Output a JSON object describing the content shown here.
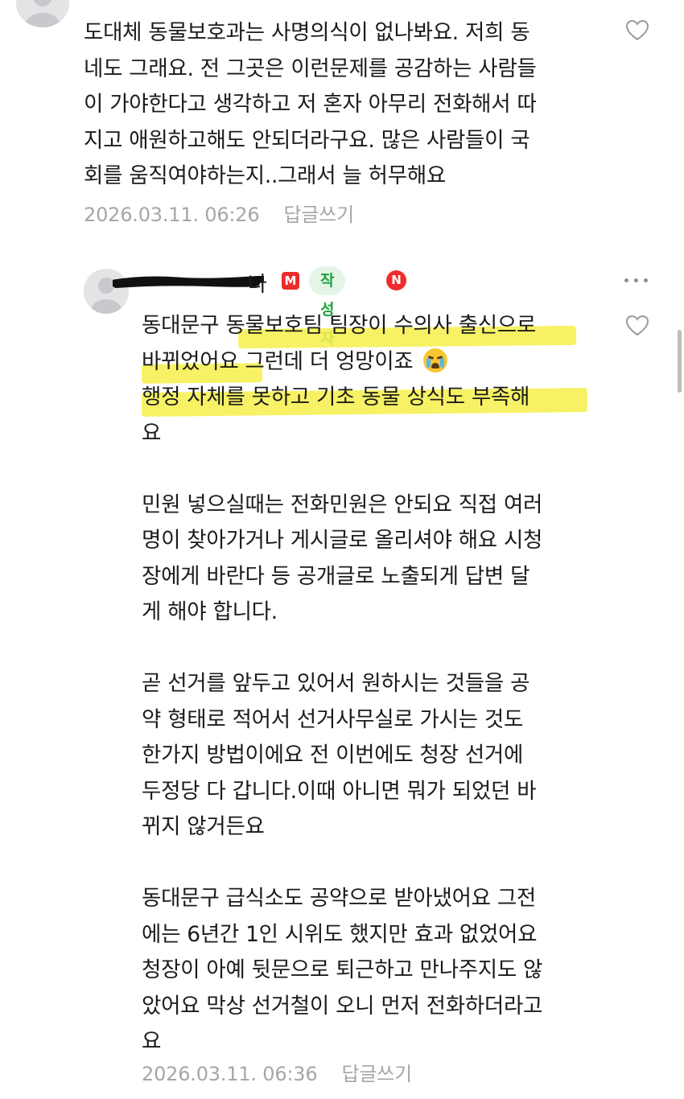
{
  "comment1": {
    "lines": [
      "도대체 동물보호과는 사명의식이 없나봐요. 저희 동",
      "네도 그래요. 전 그곳은 이런문제를 공감하는 사람들",
      "이 가야한다고 생각하고 저 혼자 아무리 전화해서 따",
      "지고 애원하고해도 안되더라구요. 많은 사람들이 국",
      "회를 움직여야하는지..그래서 늘 허무해요"
    ],
    "timestamp": "2026.03.11. 06:26",
    "reply_label": "답글쓰기"
  },
  "comment2": {
    "nickname_visible": "나",
    "badge_m": "M",
    "writer_badge": "작성자",
    "badge_n": "N",
    "lines": [
      "동대문구 동물보호팀 팀장이 수의사 출신으로",
      "바뀌었어요 그런데 더 엉망이죠",
      "행정 자체를 못하고 기초 동물 상식도 부족해",
      "요",
      "",
      "민원 넣으실때는 전화민원은 안되요 직접 여러",
      "명이 찾아가거나 게시글로 올리셔야 해요 시청",
      "장에게 바란다 등 공개글로 노출되게 답변 달",
      "게 해야 합니다.",
      "",
      "곧 선거를 앞두고 있어서 원하시는 것들을 공",
      "약 형태로 적어서 선거사무실로 가시는 것도",
      "한가지 방법이에요 전 이번에도 청장 선거에",
      "두정당 다 갑니다.이때 아니면 뭐가 되었던 바",
      "뀌지 않거든요",
      "",
      "동대문구 급식소도 공약으로 받아냈어요 그전",
      "에는 6년간 1인 시위도 했지만 효과 없었어요",
      "청장이 아예 뒷문으로 퇴근하고 만나주지도 않",
      "았어요 막상 선거철이 오니 먼저 전화하더라고",
      "요"
    ],
    "emoji": "loudly-crying-face",
    "timestamp": "2026.03.11. 06:36",
    "reply_label": "답글쓰기"
  },
  "colors": {
    "highlight": "#f6f04a",
    "writer_badge_bg": "#e4f5e7",
    "writer_badge_text": "#22a23f",
    "badge_red": "#ec2b2b",
    "meta_gray": "#a6a6a6"
  }
}
